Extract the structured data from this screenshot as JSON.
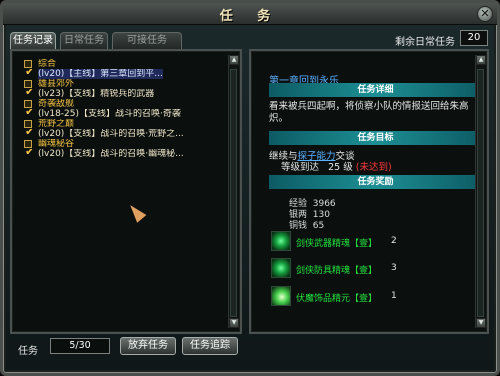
{
  "window": {
    "title": "任 务",
    "close_icon": "✕"
  },
  "tabs": [
    {
      "label": "任务记录",
      "active": true
    },
    {
      "label": "日常任务",
      "active": false
    },
    {
      "label": "可接任务",
      "active": false
    }
  ],
  "daily": {
    "label": "剩余日常任务",
    "value": "20"
  },
  "quest_tree": [
    {
      "type": "category",
      "label": "综合"
    },
    {
      "type": "quest",
      "label": "(lv20)【主线】第三章回到平...",
      "selected": true
    },
    {
      "type": "category",
      "label": "雄县郊外"
    },
    {
      "type": "quest",
      "label": "(lv23)【支线】精锐兵的武器"
    },
    {
      "type": "category",
      "label": "奇袭敌舰"
    },
    {
      "type": "quest",
      "label": "(lv18-25)【支线】战斗的召唤·奇袭"
    },
    {
      "type": "category",
      "label": "荒野之巅"
    },
    {
      "type": "quest",
      "label": "(lv20)【支线】战斗的召唤·荒野之..."
    },
    {
      "type": "category",
      "label": "幽魂秘谷"
    },
    {
      "type": "quest",
      "label": "(lv20)【支线】战斗的召唤·幽魂秘..."
    }
  ],
  "detail": {
    "quest_title": "第一章回到永乐",
    "section_detail": "任务详细",
    "description": "看来被兵四起啊，将侦察小队的情报送回给朱高炽。",
    "section_goal": "任务目标",
    "goal_prefix": "继续与",
    "goal_link": "探子能力",
    "goal_suffix": "交谈",
    "level_label": "等级到达",
    "level_value": "25",
    "level_unit": "级",
    "level_status": "(未达到)",
    "section_reward": "任务奖励",
    "rewards_stats": [
      {
        "label": "经验",
        "value": "3966"
      },
      {
        "label": "银两",
        "value": "130"
      },
      {
        "label": "铜钱",
        "value": "65"
      }
    ],
    "reward_items": [
      {
        "name": "剑侠武器精魂【壹】",
        "count": "2",
        "icon": "weapon-essence-icon"
      },
      {
        "name": "剑侠防具精魂【壹】",
        "count": "3",
        "icon": "armor-essence-icon"
      },
      {
        "name": "伏魔饰品精元【壹】",
        "count": "1",
        "icon": "jewelry-essence-icon"
      }
    ]
  },
  "footer": {
    "label": "任务",
    "count": "5/30",
    "abandon_button": "放弃任务",
    "track_button": "任务追踪"
  }
}
